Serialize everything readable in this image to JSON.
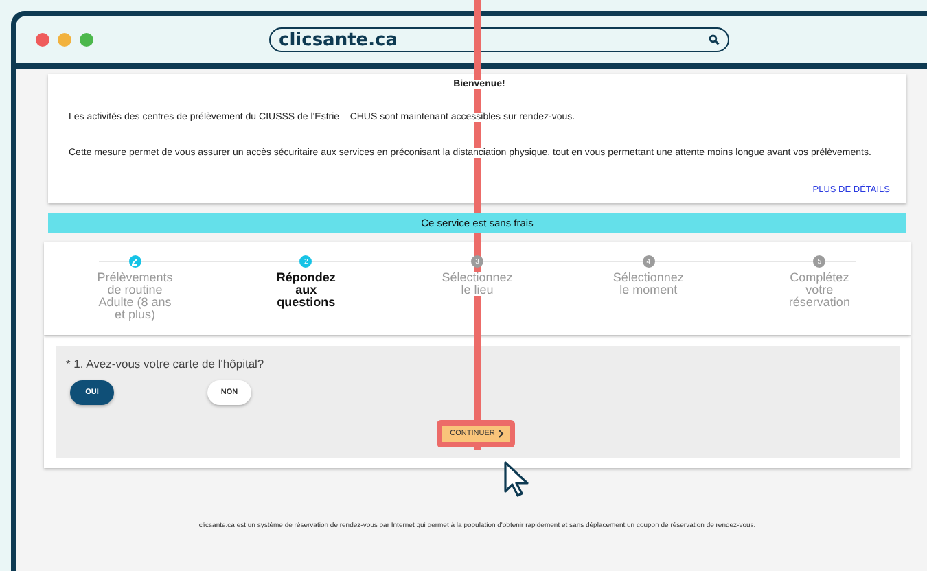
{
  "browser": {
    "address": "clicsante.ca"
  },
  "welcome": {
    "title": "Bienvenue!",
    "paragraphs": [
      "Les activités des centres de prélèvement du CIUSSS de l'Estrie – CHUS sont maintenant accessibles sur rendez-vous.",
      "Cette mesure permet de vous assurer un accès sécuritaire aux services en préconisant la distanciation physique, tout en vous permettant une attente moins longue avant vos prélèvements."
    ],
    "details_link": "PLUS DE DÉTAILS"
  },
  "banner": "Ce service est sans frais",
  "steps": [
    {
      "kind": "done",
      "label": "Prélèvements de routine Adulte (8 ans et plus)"
    },
    {
      "kind": "current",
      "number": "2",
      "label": "Répondez aux questions"
    },
    {
      "kind": "upcoming",
      "number": "3",
      "label": "Sélectionnez le lieu"
    },
    {
      "kind": "upcoming",
      "number": "4",
      "label": "Sélectionnez le moment"
    },
    {
      "kind": "upcoming",
      "number": "5",
      "label": "Complétez votre réservation"
    }
  ],
  "question": {
    "text": "* 1.  Avez-vous votre carte de l'hôpital?",
    "options": [
      {
        "label": "OUI",
        "selected": true
      },
      {
        "label": "NON",
        "selected": false
      }
    ]
  },
  "continue_button": "CONTINUER",
  "footer": "clicsante.ca est un système de réservation de rendez-vous par Internet qui permet à la population d'obtenir rapidement et sans déplacement un coupon de réservation de rendez-vous."
}
